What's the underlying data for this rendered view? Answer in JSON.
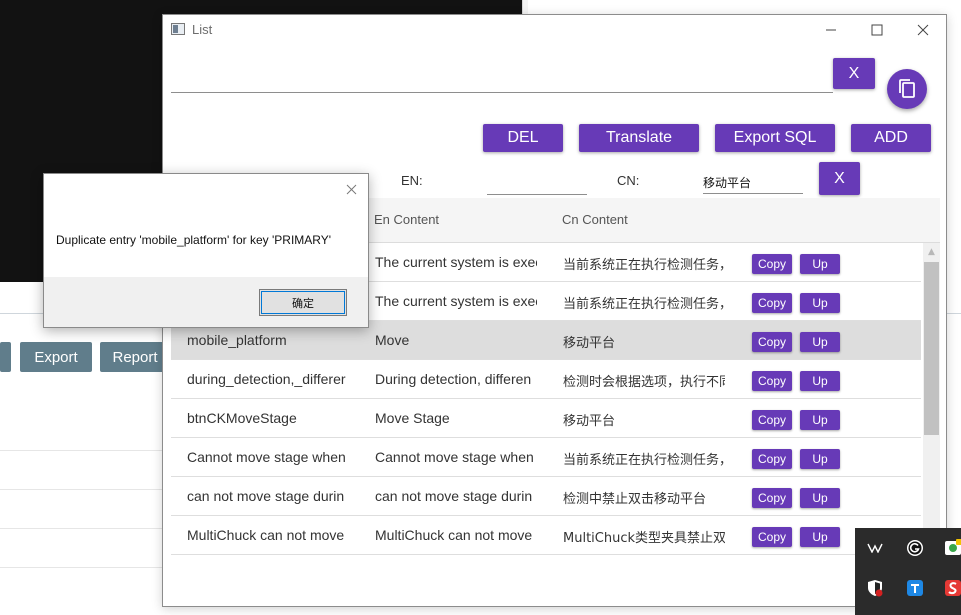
{
  "background_app": {
    "export_label": "Export",
    "report_label": "Report"
  },
  "window": {
    "title": "List",
    "minimize_glyph": "—",
    "maximize_glyph": "☐",
    "close_glyph": "✕"
  },
  "top_bar": {
    "search_value": "",
    "clear_label": "X",
    "copy_icon": "copy-icon"
  },
  "toolbar": {
    "del_label": "DEL",
    "translate_label": "Translate",
    "export_sql_label": "Export SQL",
    "add_label": "ADD"
  },
  "filters": {
    "en_label": "EN:",
    "en_value": "",
    "cn_label": "CN:",
    "cn_value": "移动平台",
    "clear_label": "X"
  },
  "table": {
    "columns": [
      "En Content",
      "Cn Content"
    ],
    "copy_label": "Copy",
    "up_label": "Up",
    "rows": [
      {
        "key": "",
        "en": "The current system is exec",
        "cn": "当前系统正在执行检测任务，"
      },
      {
        "key": "",
        "en": "The current system is exec",
        "cn": "当前系统正在执行检测任务，"
      },
      {
        "key": "mobile_platform",
        "en": "Move",
        "cn": "移动平台",
        "selected": true
      },
      {
        "key": "during_detection,_differer",
        "en": "During detection, differen",
        "cn": "检测时会根据选项，执行不同"
      },
      {
        "key": "btnCKMoveStage",
        "en": "Move Stage",
        "cn": "移动平台"
      },
      {
        "key": "Cannot move stage when",
        "en": "Cannot move stage when",
        "cn": "当前系统正在执行检测任务，"
      },
      {
        "key": "can not move stage durin",
        "en": "can not move stage durin",
        "cn": "检测中禁止双击移动平台"
      },
      {
        "key": "MultiChuck can not move",
        "en": "MultiChuck can not move",
        "cn": "MultiChuck类型夹具禁止双"
      }
    ]
  },
  "dialog": {
    "message": "Duplicate entry 'mobile_platform' for key 'PRIMARY'",
    "ok_label": "确定",
    "close_glyph": "✕"
  },
  "colors": {
    "accent": "#673ab7",
    "bg_button": "#607d8b",
    "selected_row": "#dddddd"
  },
  "tray": {
    "icons": [
      "network-icon",
      "g-app-icon",
      "wechat-icon",
      "security-shield-icon",
      "sync-app-icon",
      "sogou-icon"
    ]
  }
}
